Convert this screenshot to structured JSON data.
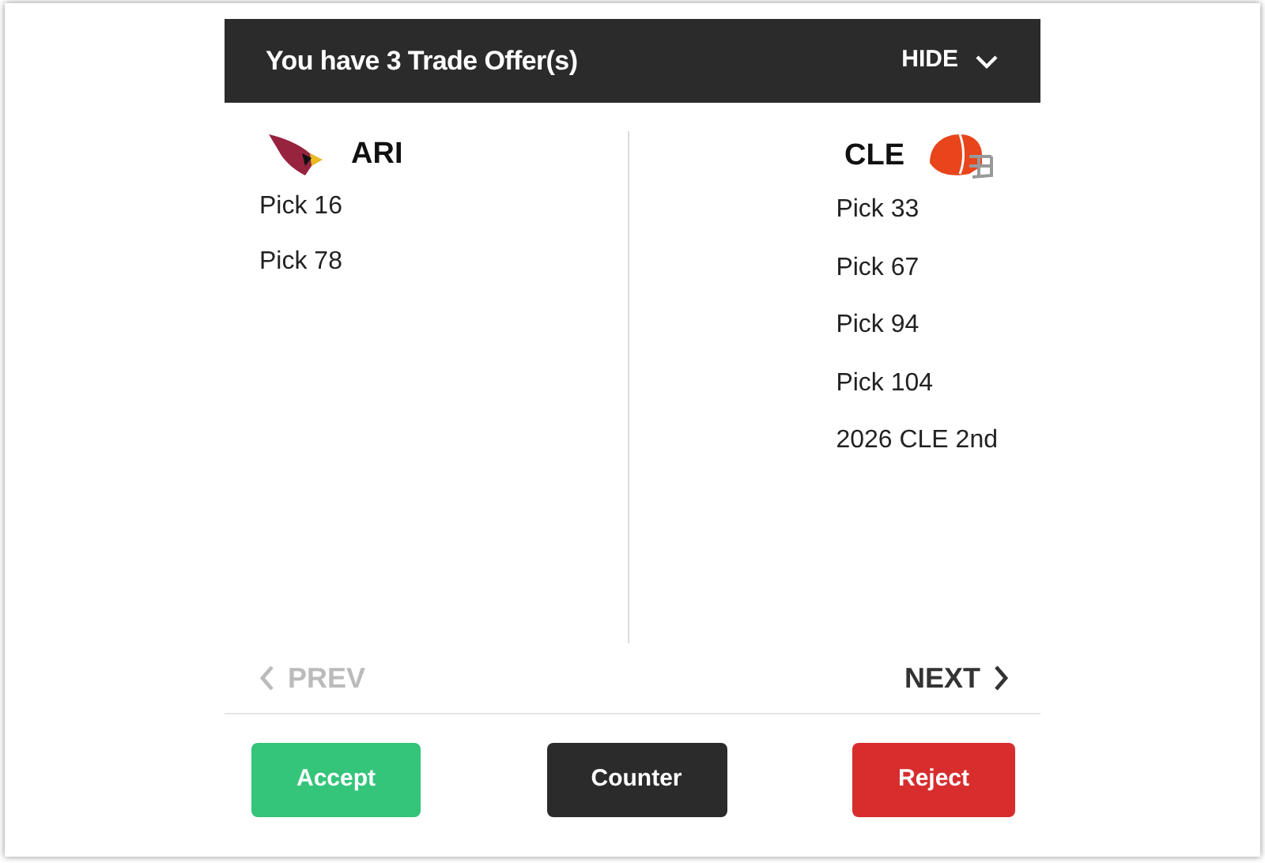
{
  "header": {
    "title": "You have 3 Trade Offer(s)",
    "toggle": "HIDE"
  },
  "teams": [
    {
      "abbr": "ARI",
      "kind": "bird",
      "picks": [
        "Pick 16",
        "Pick 78"
      ]
    },
    {
      "abbr": "CLE",
      "kind": "helmet",
      "picks": [
        "Pick 33",
        "Pick 67",
        "Pick 94",
        "Pick 104",
        "2026 CLE 2nd"
      ]
    }
  ],
  "nav": [
    {
      "label": "PREV",
      "kind": "prev",
      "disabled": true
    },
    {
      "label": "NEXT",
      "kind": "next",
      "disabled": false
    }
  ],
  "actions": [
    {
      "label": "Accept",
      "kind": "accept"
    },
    {
      "label": "Counter",
      "kind": "counter"
    },
    {
      "label": "Reject",
      "kind": "reject"
    }
  ]
}
